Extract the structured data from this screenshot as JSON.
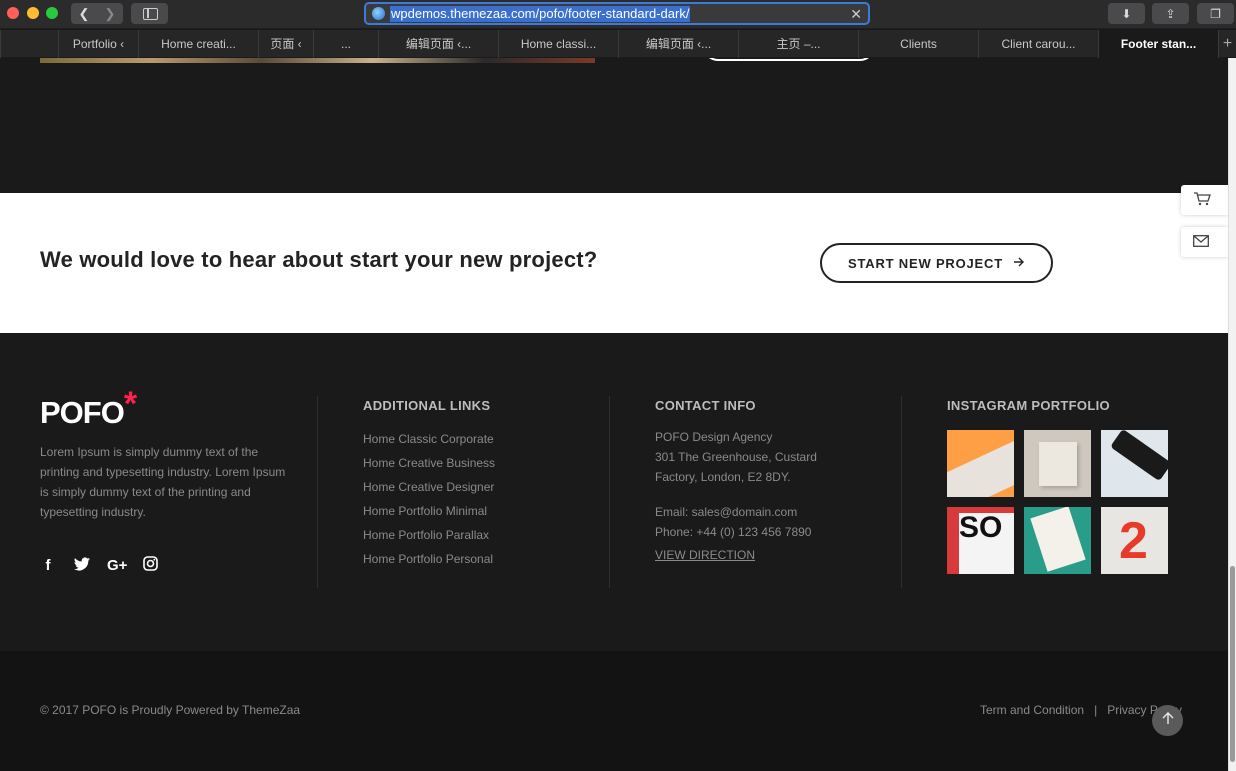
{
  "browser": {
    "url": "wpdemos.themezaa.com/pofo/footer-standard-dark/",
    "tabs": [
      {
        "label": "Portfolio ‹"
      },
      {
        "label": "Home creati..."
      },
      {
        "label": "页面 ‹"
      },
      {
        "label": "..."
      },
      {
        "label": "编辑页面 ‹..."
      },
      {
        "label": "Home classi..."
      },
      {
        "label": "编辑页面 ‹..."
      },
      {
        "label": "主页 –..."
      },
      {
        "label": "Clients"
      },
      {
        "label": "Client carou..."
      },
      {
        "label": "Footer stan..."
      }
    ]
  },
  "cta": {
    "heading": "We would love to hear about start your new project?",
    "button_label": "START NEW PROJECT"
  },
  "footer": {
    "logo_text": "POFO",
    "logo_mark": "*",
    "about": "Lorem Ipsum is simply dummy text of the printing and typesetting industry. Lorem Ipsum is simply dummy text of the printing and typesetting industry.",
    "socials": [
      "facebook",
      "twitter",
      "google-plus",
      "instagram"
    ],
    "links_title": "ADDITIONAL LINKS",
    "links": [
      "Home Classic Corporate",
      "Home Creative Business",
      "Home Creative Designer",
      "Home Portfolio Minimal",
      "Home Portfolio Parallax",
      "Home Portfolio Personal"
    ],
    "contact_title": "CONTACT INFO",
    "contact": {
      "company": "POFO Design Agency",
      "address_1": "301 The Greenhouse, Custard",
      "address_2": "Factory, London, E2 8DY.",
      "email": "Email: sales@domain.com",
      "phone": "Phone: +44 (0) 123 456 7890",
      "direction": "VIEW DIRECTION"
    },
    "instagram_title": "INSTAGRAM PORTFOLIO"
  },
  "bottom": {
    "copyright": "© 2017 POFO is Proudly Powered by ThemeZaa",
    "terms": "Term and Condition",
    "separator": "|",
    "privacy": "Privacy Policy"
  },
  "colors": {
    "accent": "#ff214f",
    "footer_bg": "#1a1a1a",
    "cta_bg": "#ffffff",
    "url_highlight": "#3b6fcd"
  }
}
